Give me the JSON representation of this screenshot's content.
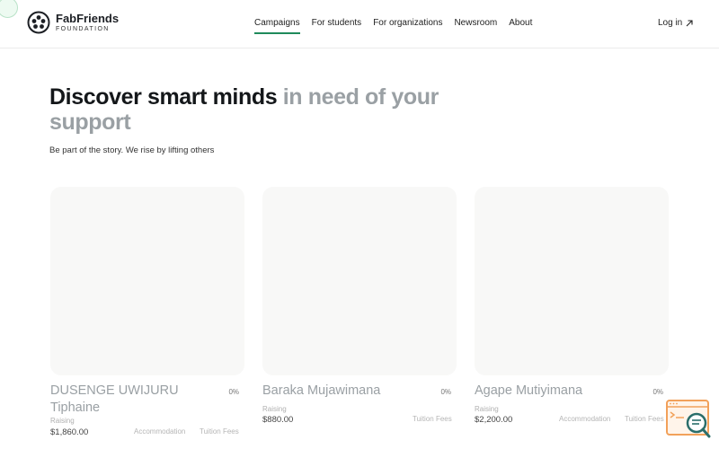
{
  "brand": {
    "name": "FabFriends",
    "subtitle": "FOUNDATION"
  },
  "nav": {
    "items": [
      {
        "label": "Campaigns",
        "active": true
      },
      {
        "label": "For students",
        "active": false
      },
      {
        "label": "For organizations",
        "active": false
      },
      {
        "label": "Newsroom",
        "active": false
      },
      {
        "label": "About",
        "active": false
      }
    ],
    "login_label": "Log in"
  },
  "hero": {
    "title_dark": "Discover smart minds",
    "title_muted": "in need of your support",
    "subtitle": "Be part of the story. We rise by lifting others"
  },
  "cards": [
    {
      "name": "DUSENGE UWIJURU Tiphaine",
      "percent": "0%",
      "raising_label": "Raising",
      "amount": "$1,860.00",
      "tags": [
        "Accommodation",
        "Tuition Fees"
      ]
    },
    {
      "name": "Baraka Mujawimana",
      "percent": "0%",
      "raising_label": "Raising",
      "amount": "$880.00",
      "tags": [
        "Tuition Fees"
      ]
    },
    {
      "name": "Agape Mutiyimana",
      "percent": "0%",
      "raising_label": "Raising",
      "amount": "$2,200.00",
      "tags": [
        "Accommodation",
        "Tuition Fees"
      ]
    }
  ],
  "colors": {
    "accent": "#1f8a5b",
    "muted_text": "#9aa0a4",
    "widget": "#f2a15a"
  },
  "icons": {
    "logo": "fabfriends-logo-icon",
    "login": "arrow-up-right-icon",
    "support": "chat-search-icon"
  }
}
